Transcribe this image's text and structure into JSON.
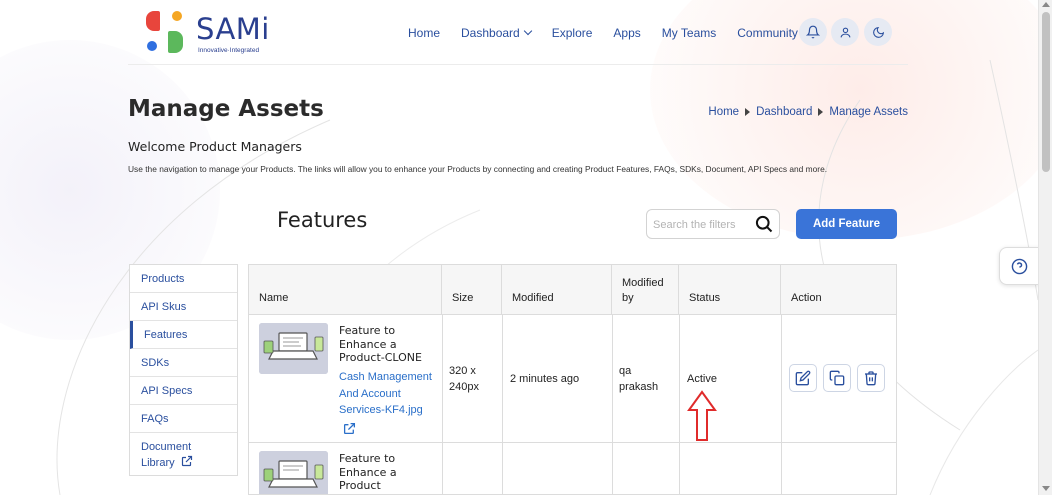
{
  "brand": {
    "name": "SAMi",
    "tagline": "Innovative·Integrated",
    "colors": {
      "red": "#e8453c",
      "orange": "#f5a623",
      "blue": "#2f6fe0",
      "green": "#5cb85c"
    }
  },
  "nav": {
    "items": [
      {
        "label": "Home"
      },
      {
        "label": "Dashboard",
        "dropdown": true
      },
      {
        "label": "Explore"
      },
      {
        "label": "Apps"
      },
      {
        "label": "My Teams"
      },
      {
        "label": "Community",
        "dropdown": true
      }
    ],
    "icons": [
      "bell-icon",
      "user-icon",
      "moon-icon"
    ]
  },
  "page": {
    "title": "Manage Assets",
    "breadcrumb": [
      "Home",
      "Dashboard",
      "Manage Assets"
    ],
    "welcome": "Welcome Product Managers",
    "intro": "Use the navigation to manage your Products. The links will allow you to enhance your Products by connecting and creating Product Features, FAQs, SDKs, Document, API Specs and more."
  },
  "features": {
    "title": "Features",
    "search_placeholder": "Search the filters",
    "add_label": "Add Feature"
  },
  "sidebar": {
    "items": [
      {
        "label": "Products"
      },
      {
        "label": "API Skus"
      },
      {
        "label": "Features",
        "active": true
      },
      {
        "label": "SDKs"
      },
      {
        "label": "API Specs"
      },
      {
        "label": "FAQs"
      },
      {
        "label": "Document Library",
        "external": true
      }
    ]
  },
  "table": {
    "headers": [
      "Name",
      "Size",
      "Modified",
      "Modified by",
      "Status",
      "Action"
    ],
    "rows": [
      {
        "name": "Feature to Enhance a Product-CLONE",
        "file": "Cash Management And Account Services-KF4.jpg",
        "size": "320 x 240px",
        "modified": "2 minutes ago",
        "modified_by": "qa prakash",
        "status": "Active",
        "actions": [
          "edit-icon",
          "copy-icon",
          "trash-icon"
        ]
      },
      {
        "name": "Feature to Enhance a Product"
      }
    ]
  },
  "accent": {
    "link": "#2a4f9e",
    "primary": "#3a74d8",
    "annotation": "#e02b2b"
  }
}
